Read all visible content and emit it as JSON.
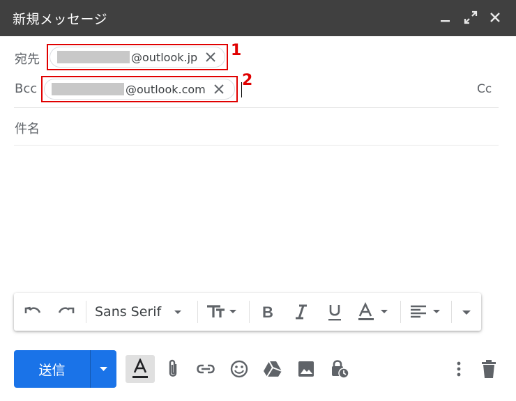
{
  "window": {
    "title": "新規メッセージ",
    "controls": [
      "minimize-icon",
      "expand-icon",
      "close-icon"
    ]
  },
  "to_row": {
    "label": "宛先",
    "recipient": {
      "domain": "@outlook.jp"
    },
    "callout": "1"
  },
  "bcc_row": {
    "label": "Bcc",
    "recipient": {
      "domain": "@outlook.com"
    },
    "callout": "2",
    "cc_link": "Cc"
  },
  "subject": {
    "placeholder": "件名"
  },
  "callout_color": "#e00000",
  "format_toolbar": {
    "font": "Sans Serif",
    "icons": [
      "undo-icon",
      "redo-icon",
      "font-size-icon",
      "bold-icon",
      "italic-icon",
      "underline-icon",
      "text-color-icon",
      "align-icon",
      "more-formatting-icon"
    ]
  },
  "bottom_bar": {
    "send_label": "送信",
    "send_color": "#1a73e8",
    "icons": [
      "formatting-options-icon",
      "attach-icon",
      "link-icon",
      "emoji-icon",
      "drive-icon",
      "photo-icon",
      "confidential-mode-icon",
      "more-options-icon",
      "discard-icon"
    ]
  }
}
